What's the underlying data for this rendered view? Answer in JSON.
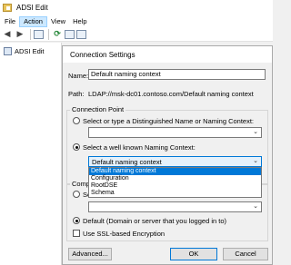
{
  "app": {
    "title": "ADSI Edit"
  },
  "menu": [
    "File",
    "Action",
    "View",
    "Help"
  ],
  "tree": {
    "root_label": "ADSI Edit"
  },
  "dialog": {
    "title": "Connection Settings",
    "name_label": "Name:",
    "name_value": "Default naming context",
    "path_label": "Path:",
    "path_value": "LDAP://msk-dc01.contoso.com/Default naming context",
    "connection_point": {
      "group_label": "Connection Point",
      "dn_radio_label": "Select or type a Distinguished Name or Naming Context:",
      "dn_combo_value": "",
      "wellknown_radio_label": "Select a well known Naming Context:",
      "wellknown_selected": "Default naming context",
      "options": [
        "Default naming context",
        "Configuration",
        "RootDSE",
        "Schema"
      ]
    },
    "computer": {
      "group_label": "Comp",
      "select_radio_label": "Se",
      "server_combo_value": "",
      "default_radio_label": "Default (Domain or server that you logged in to)",
      "ssl_label": "Use SSL-based Encryption"
    },
    "buttons": {
      "advanced": "Advanced...",
      "ok": "OK",
      "cancel": "Cancel"
    }
  }
}
